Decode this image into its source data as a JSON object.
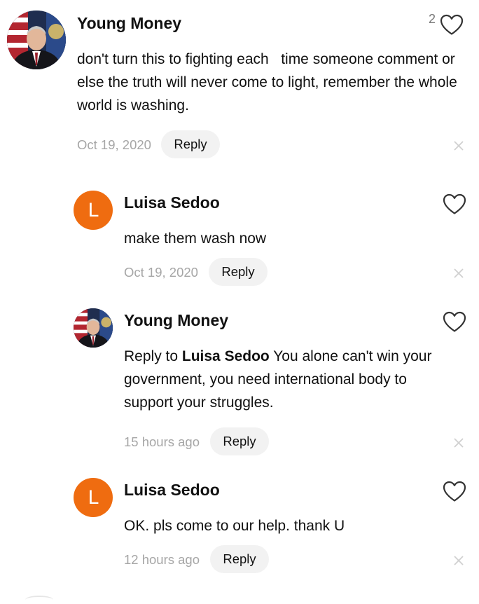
{
  "comments": [
    {
      "author": "Young Money",
      "avatar_type": "photo",
      "text": "don't turn this to fighting each   time someone comment or else the truth will never come to light, remember the whole world is washing.",
      "date": "Oct 19, 2020",
      "reply_label": "Reply",
      "like_count": "2"
    },
    {
      "author": "Luisa Sedoo",
      "avatar_type": "letter",
      "avatar_letter": "L",
      "text": "make them wash now",
      "date": "Oct 19, 2020",
      "reply_label": "Reply"
    },
    {
      "author": "Young Money",
      "avatar_type": "photo",
      "reply_to_prefix": "Reply to",
      "reply_to_name": "Luisa Sedoo",
      "text": "You alone can't win your government, you need international body to support your struggles.",
      "date": "15 hours ago",
      "reply_label": "Reply"
    },
    {
      "author": "Luisa Sedoo",
      "avatar_type": "letter",
      "avatar_letter": "L",
      "text": "OK. pls come to our help. thank U",
      "date": "12 hours ago",
      "reply_label": "Reply"
    }
  ],
  "colors": {
    "letter_avatar_bg": "#ef6c10",
    "date_text": "#a6a6a6",
    "reply_button_bg": "#f2f2f2"
  },
  "icons": {
    "like": "heart-outline-icon",
    "dismiss": "close-icon"
  }
}
